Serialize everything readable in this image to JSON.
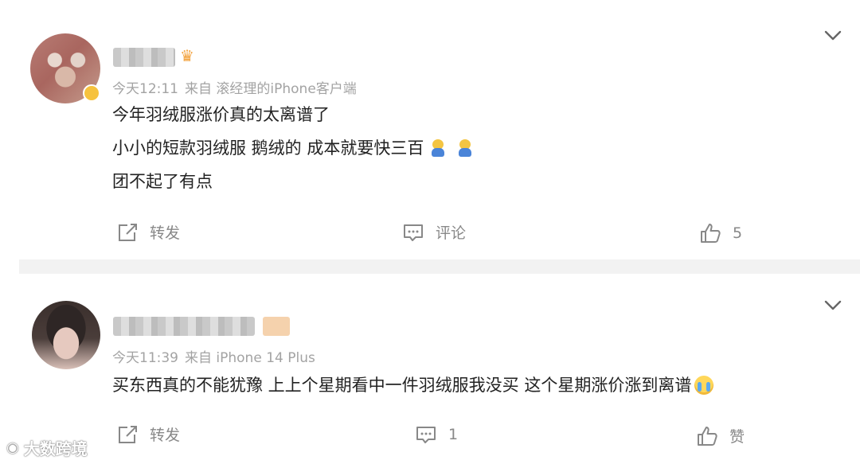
{
  "comments": [
    {
      "time": "今天12:11",
      "source": "来自 滚经理的iPhone客户端",
      "lines": [
        "今年羽绒服涨价真的太离谱了",
        "小小的短款羽绒服 鹅绒的 成本就要快三百",
        "团不起了有点"
      ],
      "actions": {
        "repost": "转发",
        "comment": "评论",
        "like": "5"
      }
    },
    {
      "time": "今天11:39",
      "source": "来自 iPhone 14 Plus",
      "lines": [
        "买东西真的不能犹豫 上上个星期看中一件羽绒服我没买 这个星期涨价涨到离谱"
      ],
      "actions": {
        "repost": "转发",
        "comment": "1",
        "like": "赞"
      }
    }
  ],
  "watermark": {
    "text": "大数跨境",
    "logo": "weibo-logo"
  },
  "icons": [
    "avatar",
    "crown-icon",
    "chevron-down-icon",
    "repost-icon",
    "comment-icon",
    "like-icon",
    "sad-emoji-icon",
    "crying-emoji-icon"
  ],
  "colors": {
    "background": "#ffffff",
    "meta_text": "#a3a3a3",
    "body_text": "#222222",
    "divider": "#f2f2f2",
    "action_text": "#888888"
  }
}
